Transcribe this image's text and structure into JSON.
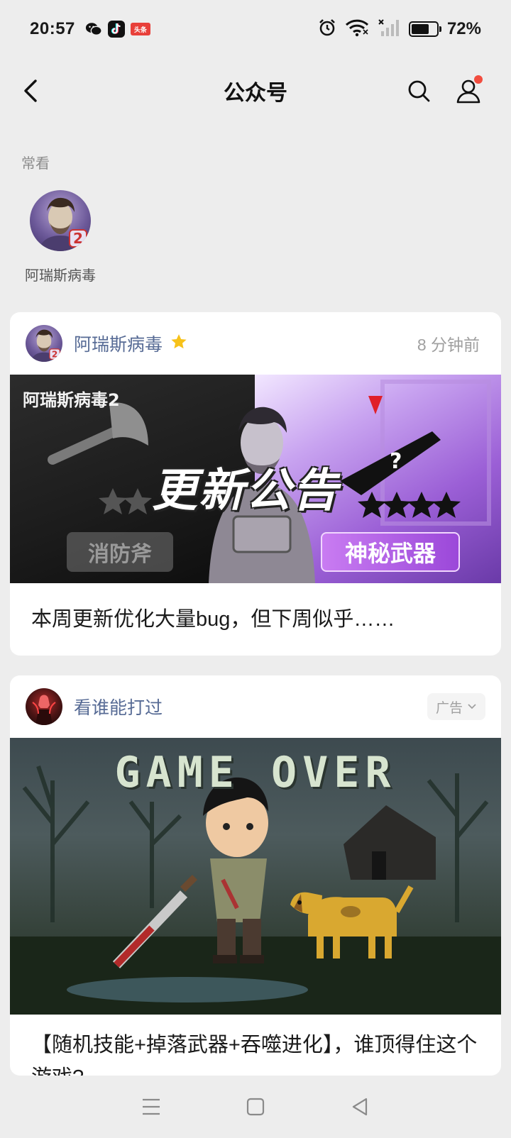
{
  "status_bar": {
    "time": "20:57",
    "app_badges": {
      "toutiao": "头条"
    },
    "battery_level": 0.72,
    "battery_text": "72%"
  },
  "header": {
    "title": "公众号"
  },
  "frequent": {
    "section_label": "常看",
    "accounts": [
      {
        "name": "阿瑞斯病毒"
      }
    ]
  },
  "feed": [
    {
      "account_name": "阿瑞斯病毒",
      "time_ago": "8 分钟前",
      "cover": {
        "brand": "阿瑞斯病毒2",
        "headline": "更新公告",
        "tag_left": "消防斧",
        "tag_right": "神秘武器"
      },
      "title": "本周更新优化大量bug，但下周似乎……"
    },
    {
      "account_name": "看谁能打过",
      "ad_label": "广告",
      "cover": {
        "headline": "GAME OVER"
      },
      "title": "【随机技能+掉落武器+吞噬进化】，谁顶得住这个游戏?"
    }
  ],
  "colors": {
    "background": "#ededed",
    "link_blue": "#576b95",
    "notification_red": "#f24d3f",
    "star_gold": "#f7c21a"
  }
}
